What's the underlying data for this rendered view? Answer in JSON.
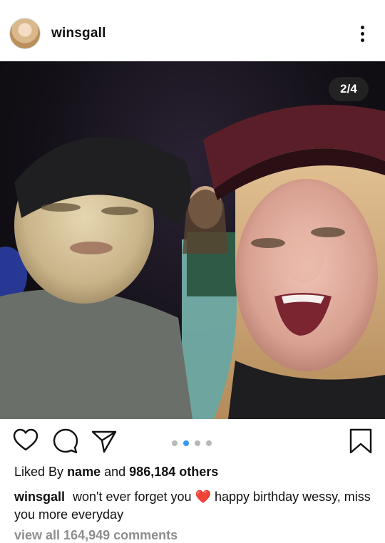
{
  "post": {
    "username": "winsgall",
    "more_icon": "more-vertical-icon",
    "photo_counter": "2/4",
    "carousel": {
      "total": 4,
      "active_index": 1
    },
    "likes": {
      "prefix": "Liked By",
      "name": "name",
      "and": "and",
      "count": "986,184 others"
    },
    "caption": {
      "username": "winsgall",
      "text_before_emoji": "won't ever forget you",
      "emoji": "❤️",
      "text_after_emoji": "happy birthday wessy, miss you more everyday"
    },
    "view_all_comments": "view all 164,949 comments",
    "icons": {
      "like": "heart-icon",
      "comment": "comment-icon",
      "share": "send-icon",
      "save": "bookmark-icon"
    },
    "colors": {
      "active_dot": "#3897f0",
      "inactive_dot": "#b8b8b8",
      "heart": "#e0245e"
    }
  }
}
